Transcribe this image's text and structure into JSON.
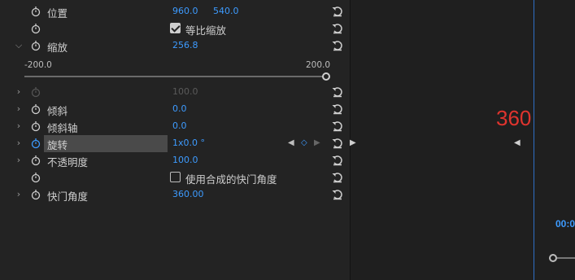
{
  "properties": [
    {
      "label": "位置",
      "v1": "960.0",
      "v2": "540.0"
    },
    {
      "checkbox_label": "等比缩放"
    },
    {
      "label": "缩放",
      "value": "256.8",
      "slider_min": "-200.0",
      "slider_max": "200.0"
    },
    {
      "value": "100.0"
    },
    {
      "label": "倾斜",
      "value": "0.0"
    },
    {
      "label": "倾斜轴",
      "value": "0.0"
    },
    {
      "label": "旋转",
      "value": "1x0.0 °"
    },
    {
      "label": "不透明度",
      "value": "100.0"
    },
    {
      "checkbox_label": "使用合成的快门角度"
    },
    {
      "label": "快门角度",
      "value": "360.00"
    }
  ],
  "overlay": {
    "annotation": "360",
    "timecode": "00:0"
  }
}
